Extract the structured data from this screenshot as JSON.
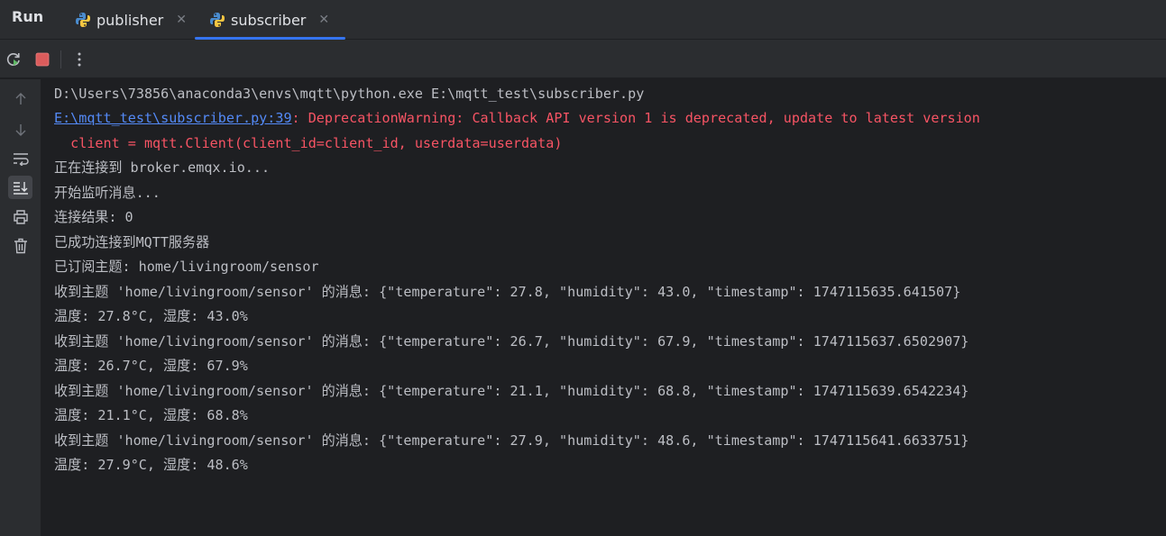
{
  "tabbar": {
    "title": "Run",
    "tabs": [
      {
        "label": "publisher",
        "icon": "python-icon",
        "active": false
      },
      {
        "label": "subscriber",
        "icon": "python-icon",
        "active": true
      }
    ]
  },
  "toolbar": {
    "buttons": [
      "rerun-icon",
      "stop-icon",
      "more-icon"
    ]
  },
  "sidebar": {
    "buttons": [
      "arrow-up-icon",
      "arrow-down-icon",
      "soft-wrap-icon",
      "scroll-to-end-icon",
      "print-icon",
      "trash-icon"
    ]
  },
  "console": {
    "command": "D:\\Users\\73856\\anaconda3\\envs\\mqtt\\python.exe E:\\mqtt_test\\subscriber.py",
    "warning_link": "E:\\mqtt_test\\subscriber.py:39",
    "warning_text": ": DeprecationWarning: Callback API version 1 is deprecated, update to latest version",
    "warning_code": "  client = mqtt.Client(client_id=client_id, userdata=userdata)",
    "lines": [
      "正在连接到 broker.emqx.io...",
      "开始监听消息...",
      "连接结果: 0",
      "已成功连接到MQTT服务器",
      "已订阅主题: home/livingroom/sensor",
      "收到主题 'home/livingroom/sensor' 的消息: {\"temperature\": 27.8, \"humidity\": 43.0, \"timestamp\": 1747115635.641507}",
      "温度: 27.8°C, 湿度: 43.0%",
      "收到主题 'home/livingroom/sensor' 的消息: {\"temperature\": 26.7, \"humidity\": 67.9, \"timestamp\": 1747115637.6502907}",
      "温度: 26.7°C, 湿度: 67.9%",
      "收到主题 'home/livingroom/sensor' 的消息: {\"temperature\": 21.1, \"humidity\": 68.8, \"timestamp\": 1747115639.6542234}",
      "温度: 21.1°C, 湿度: 68.8%",
      "收到主题 'home/livingroom/sensor' 的消息: {\"temperature\": 27.9, \"humidity\": 48.6, \"timestamp\": 1747115641.6633751}",
      "温度: 27.9°C, 湿度: 48.6%"
    ]
  },
  "colors": {
    "background": "#1e1f22",
    "panel": "#2b2d30",
    "accent": "#3574f0",
    "error": "#f75464",
    "link": "#548af7",
    "text": "#bcbec4"
  }
}
